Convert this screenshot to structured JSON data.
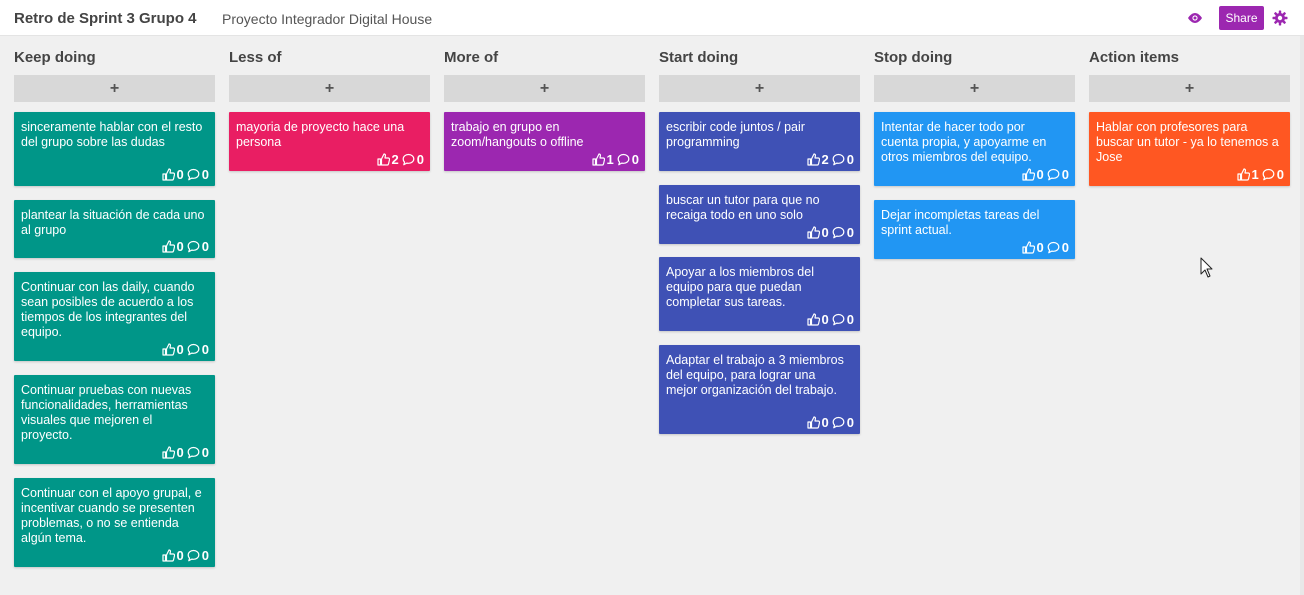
{
  "header": {
    "title": "Retro de Sprint 3 Grupo 4",
    "subtitle": "Proyecto Integrador Digital House",
    "share_label": "Share",
    "view_icon": "eye-icon",
    "settings_icon": "gear-icon"
  },
  "colors": {
    "teal": "#009688",
    "pink": "#e91e63",
    "purple": "#9c27b0",
    "indigo": "#3f51b5",
    "blue": "#2196f3",
    "orange": "#ff5722"
  },
  "columns": [
    {
      "title": "Keep doing",
      "add_label": "+",
      "cards": [
        {
          "text": "sinceramente hablar con el resto del grupo sobre las dudas",
          "likes": "0",
          "comments": "0"
        },
        {
          "text": "plantear la situación de cada uno al grupo",
          "likes": "0",
          "comments": "0"
        },
        {
          "text": "Continuar con las daily, cuando sean posibles de acuerdo a los tiempos de los integrantes del equipo.",
          "likes": "0",
          "comments": "0"
        },
        {
          "text": "Continuar pruebas con nuevas funcionalidades, herramientas visuales que mejoren el proyecto.",
          "likes": "0",
          "comments": "0"
        },
        {
          "text": "Continuar con el apoyo grupal, e incentivar cuando se presenten problemas, o no se entienda algún tema.",
          "likes": "0",
          "comments": "0"
        }
      ]
    },
    {
      "title": "Less of",
      "add_label": "+",
      "cards": [
        {
          "text": "mayoria de proyecto hace una persona",
          "likes": "2",
          "comments": "0"
        }
      ]
    },
    {
      "title": "More of",
      "add_label": "+",
      "cards": [
        {
          "text": "trabajo en grupo en zoom/hangouts o offline",
          "likes": "1",
          "comments": "0"
        }
      ]
    },
    {
      "title": "Start doing",
      "add_label": "+",
      "cards": [
        {
          "text": "escribir code juntos / pair programming",
          "likes": "2",
          "comments": "0"
        },
        {
          "text": "buscar un tutor para que no recaiga todo en uno solo",
          "likes": "0",
          "comments": "0"
        },
        {
          "text": "Apoyar a los miembros del equipo para que puedan completar sus tareas.",
          "likes": "0",
          "comments": "0"
        },
        {
          "text": "Adaptar el trabajo a 3 miembros del equipo, para lograr una mejor organización del trabajo.",
          "likes": "0",
          "comments": "0"
        }
      ]
    },
    {
      "title": "Stop doing",
      "add_label": "+",
      "cards": [
        {
          "text": "Intentar de hacer todo por cuenta propia, y apoyarme en otros miembros del equipo.",
          "likes": "0",
          "comments": "0"
        },
        {
          "text": "Dejar incompletas tareas del sprint actual.",
          "likes": "0",
          "comments": "0"
        }
      ]
    },
    {
      "title": "Action items",
      "add_label": "+",
      "cards": [
        {
          "text": "Hablar con profesores para buscar un tutor - ya lo tenemos a Jose",
          "likes": "1",
          "comments": "0"
        }
      ]
    }
  ]
}
